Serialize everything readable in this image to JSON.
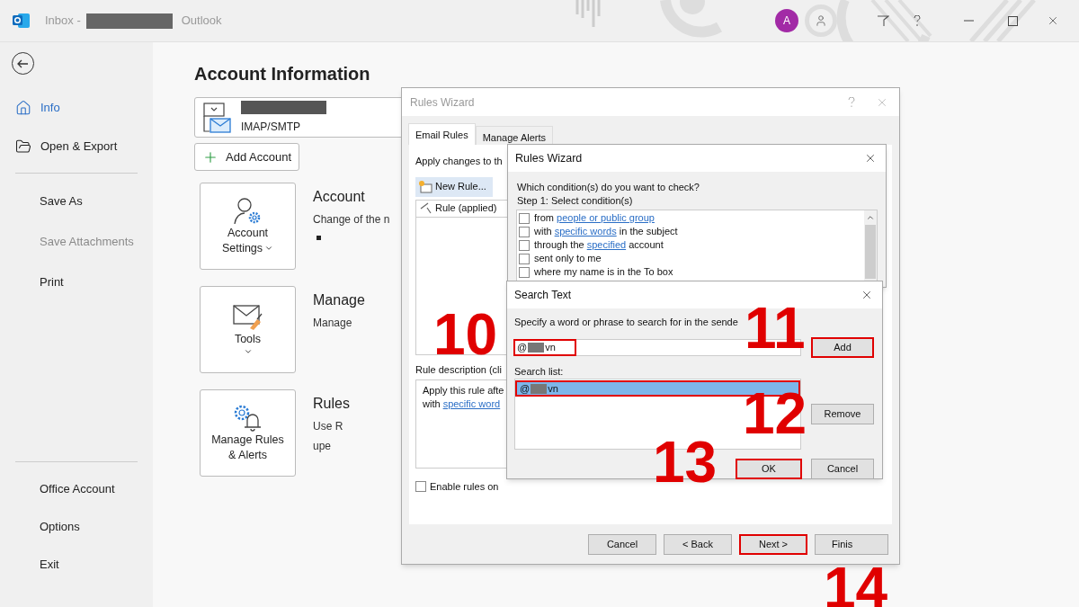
{
  "title_bar": {
    "inbox": "Inbox -",
    "app": "Outlook",
    "avatar": "A"
  },
  "sidebar": {
    "groups": [
      [
        {
          "label": "Info",
          "selected": true,
          "disabled": false
        },
        {
          "label": "Open & Export",
          "selected": false,
          "disabled": false
        }
      ],
      [
        {
          "label": "Save As",
          "selected": false,
          "disabled": false
        },
        {
          "label": "Save Attachments",
          "selected": false,
          "disabled": true
        },
        {
          "label": "Print",
          "selected": false,
          "disabled": false
        }
      ],
      [
        {
          "label": "Office Account",
          "selected": false,
          "disabled": false
        },
        {
          "label": "Options",
          "selected": false,
          "disabled": false
        },
        {
          "label": "Exit",
          "selected": false,
          "disabled": false
        }
      ]
    ]
  },
  "main": {
    "title": "Account Information",
    "account_type": "IMAP/SMTP",
    "add_account": "Add Account",
    "sections": [
      {
        "tile": [
          "Account",
          "Settings"
        ],
        "heading": "Account",
        "lines": [
          "Change of the n"
        ]
      },
      {
        "tile": [
          "Tools"
        ],
        "heading": "Manage",
        "lines": [
          "Manage"
        ]
      },
      {
        "tile": [
          "Manage Rules",
          "& Alerts"
        ],
        "heading": "Rules",
        "lines": [
          "Use R",
          "upe"
        ]
      }
    ]
  },
  "rules_dialog": {
    "title": "Rules Wizard",
    "tabs": [
      {
        "label": "Email Rules",
        "selected": true
      },
      {
        "label": "Manage Alerts",
        "selected": false
      }
    ],
    "apply_text": "Apply changes to th",
    "new_rule": "New Rule...",
    "column": "Rule (applied)",
    "description_label": "Rule description (cli",
    "description": [
      {
        "text": "Apply this rule afte"
      },
      {
        "text": "with",
        "link": "specific word"
      }
    ],
    "enable": {
      "label": "Enable rules on",
      "checked": false
    },
    "buttons": [
      {
        "label": "Cancel",
        "highlighted": false
      },
      {
        "label": "< Back",
        "highlighted": false
      },
      {
        "label": "Next >",
        "highlighted": true
      },
      {
        "label": "Finis",
        "highlighted": false
      }
    ]
  },
  "wizard": {
    "title": "Rules Wizard",
    "question": "Which condition(s) do you want to check?",
    "step": "Step 1: Select condition(s)",
    "conditions": [
      {
        "text": "from",
        "link": "people or public group",
        "checked": false
      },
      {
        "text": "with",
        "link": "specific words",
        "after": "in the subject",
        "checked": false
      },
      {
        "text": "through the",
        "link": "specified",
        "after": "account",
        "checked": false
      },
      {
        "text": "sent only to me",
        "checked": false
      },
      {
        "text": "where my name is in the To box",
        "checked": false
      }
    ]
  },
  "search_text": {
    "title": "Search Text",
    "prompt": "Specify a word or phrase to search for in the sende",
    "input": {
      "prefix": "@",
      "suffix": "vn",
      "highlighted": true
    },
    "add": {
      "label": "Add",
      "highlighted": true
    },
    "list_label": "Search list:",
    "list_items": [
      {
        "prefix": "@",
        "suffix": "vn",
        "selected": true,
        "highlighted": true
      }
    ],
    "remove": {
      "label": "Remove",
      "highlighted": false
    },
    "ok": {
      "label": "OK",
      "highlighted": true
    },
    "cancel": {
      "label": "Cancel",
      "highlighted": false
    }
  },
  "step_numbers": [
    "10",
    "11",
    "12",
    "13",
    "14"
  ]
}
